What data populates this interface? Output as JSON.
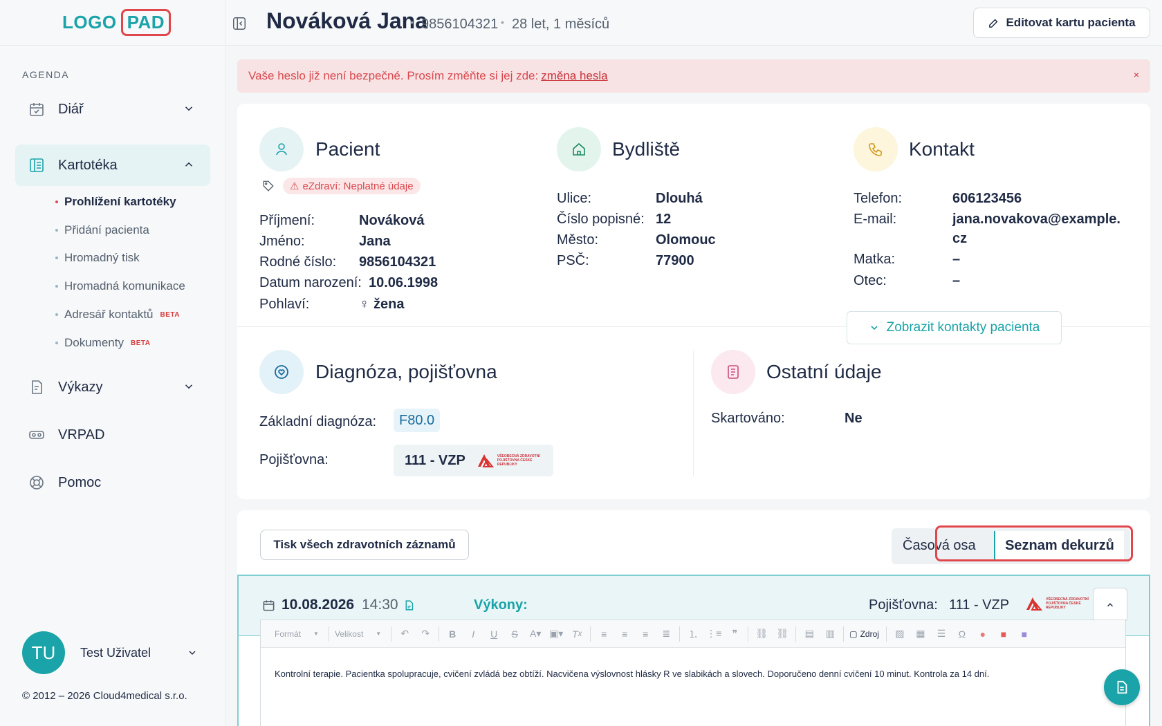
{
  "logo": {
    "part1": "LOGO",
    "part2": "PAD"
  },
  "sidebar": {
    "section_title": "AGENDA",
    "items": [
      {
        "label": "Diář",
        "icon": "calendar-icon"
      },
      {
        "label": "Kartotéka",
        "icon": "address-book-icon"
      },
      {
        "label": "Výkazy",
        "icon": "report-icon"
      },
      {
        "label": "VRPAD",
        "icon": "vr-headset-icon"
      },
      {
        "label": "Pomoc",
        "icon": "lifebuoy-icon"
      }
    ],
    "sub_items": [
      {
        "label": "Prohlížení kartotéky"
      },
      {
        "label": "Přidání pacienta"
      },
      {
        "label": "Hromadný tisk"
      },
      {
        "label": "Hromadná komunikace"
      },
      {
        "label": "Adresář kontaktů",
        "badge": "BETA"
      },
      {
        "label": "Dokumenty",
        "badge": "BETA"
      }
    ],
    "user": {
      "initials": "TU",
      "name": "Test Uživatel"
    },
    "copyright": "© 2012 – 2026 Cloud4medical s.r.o."
  },
  "header": {
    "patient_name": "Nováková Jana",
    "birth_number": "9856104321",
    "age": "28 let, 1 měsíců",
    "edit_button": "Editovat kartu pacienta"
  },
  "alert": {
    "text": "Vaše heslo již není bezpečné. Prosím změňte si jej zde:",
    "link": "změna hesla",
    "close": "×"
  },
  "patient": {
    "title": "Pacient",
    "ezdravi": "eZdraví: Neplatné údaje",
    "fields": [
      {
        "label": "Příjmení:",
        "value": "Nováková"
      },
      {
        "label": "Jméno:",
        "value": "Jana"
      },
      {
        "label": "Rodné číslo:",
        "value": "9856104321"
      },
      {
        "label": "Datum narození:",
        "value": "10.06.1998"
      },
      {
        "label": "Pohlaví:",
        "value": "žena"
      }
    ]
  },
  "address": {
    "title": "Bydliště",
    "fields": [
      {
        "label": "Ulice:",
        "value": "Dlouhá"
      },
      {
        "label": "Číslo popisné:",
        "value": "12"
      },
      {
        "label": "Město:",
        "value": "Olomouc"
      },
      {
        "label": "PSČ:",
        "value": "77900"
      }
    ]
  },
  "contact": {
    "title": "Kontakt",
    "phone_label": "Telefon:",
    "phone": "606123456",
    "email_label": "E-mail:",
    "email_line1": "jana.novakova@example.",
    "email_line2": "cz",
    "mother_label": "Matka:",
    "mother": "–",
    "father_label": "Otec:",
    "father": "–",
    "show_button": "Zobrazit kontakty pacienta"
  },
  "diagnosis": {
    "title": "Diagnóza, pojišťovna",
    "dx_label": "Základní diagnóza:",
    "dx_value": "F80.0",
    "ins_label": "Pojišťovna:",
    "ins_value": "111 - VZP"
  },
  "other": {
    "title": "Ostatní údaje",
    "shredded_label": "Skartováno:",
    "shredded_value": "Ne"
  },
  "vzp_logo_text": "VŠEOBECNÁ ZDRAVOTNÍ POJIŠŤOVNA ČESKÉ REPUBLIKY",
  "records": {
    "print_button": "Tisk všech zdravotních záznamů",
    "toggle_timeline": "Časová osa",
    "toggle_list": "Seznam dekurzů",
    "entry": {
      "date": "10.08.2026",
      "time": "14:30",
      "vykony_label": "Výkony:",
      "ins_label": "Pojišťovna:",
      "ins_value": "111 - VZP"
    },
    "editor": {
      "format": "Formát",
      "size": "Velikost",
      "source": "Zdroj",
      "text": "Kontrolní terapie. Pacientka spolupracuje, cvičení zvládá bez obtíží. Nacvičena výslovnost hlásky R ve slabikách a slovech. Doporučeno denní cvičení 10 minut. Kontrola za 14 dní."
    }
  },
  "colors": {
    "accent": "#1aa3a8",
    "alert_bg": "#f8e3e4",
    "alert_text": "#d9494f",
    "highlight": "#e0474c"
  }
}
